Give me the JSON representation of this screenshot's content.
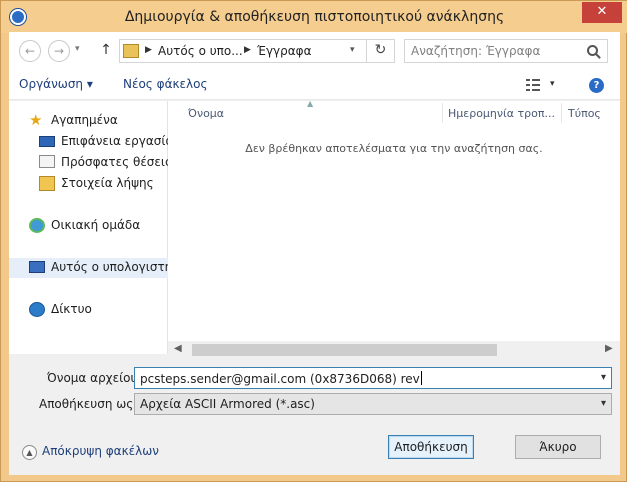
{
  "window": {
    "title": "Δημιουργία & αποθήκευση πιστοποιητικού ανάκλησης",
    "close_glyph": "✕"
  },
  "nav": {
    "back_glyph": "←",
    "forward_glyph": "→",
    "dropdown_glyph": "▾",
    "up_glyph": "↑",
    "breadcrumb": [
      "Αυτός ο υπο...",
      "Έγγραφα"
    ],
    "crumb_arrow": "▶",
    "refresh_glyph": "↻",
    "search_placeholder": "Αναζήτηση: Έγγραφα"
  },
  "toolbar": {
    "organize": "Οργάνωση ▾",
    "new_folder": "Νέος φάκελος",
    "view_dropdown_glyph": "▾",
    "help_glyph": "?"
  },
  "sidebar": {
    "items": [
      {
        "label": "Αγαπημένα",
        "icon": "star-icon"
      },
      {
        "label": "Επιφάνεια εργασίας",
        "icon": "desktop-icon"
      },
      {
        "label": "Πρόσφατες θέσεις",
        "icon": "recent-places-icon"
      },
      {
        "label": "Στοιχεία λήψης",
        "icon": "downloads-icon"
      },
      {
        "label": "Οικιακή ομάδα",
        "icon": "homegroup-icon"
      },
      {
        "label": "Αυτός ο υπολογιστής",
        "icon": "computer-icon",
        "selected": true
      },
      {
        "label": "Δίκτυο",
        "icon": "network-icon"
      }
    ],
    "star_glyph": "★"
  },
  "filelist": {
    "columns": [
      "Όνομα",
      "Ημερομηνία τροπ...",
      "Τύπος"
    ],
    "sort_glyph": "▲",
    "empty_message": "Δεν βρέθηκαν αποτελέσματα για την αναζήτηση σας.",
    "scroll_left_glyph": "◀",
    "scroll_right_glyph": "▶"
  },
  "form": {
    "filename_label": "Όνομα αρχείου:",
    "filename_value": "pcsteps.sender@gmail.com (0x8736D068) rev",
    "savetype_label": "Αποθήκευση ως:",
    "savetype_value": "Αρχεία ASCII Armored (*.asc)",
    "dropdown_glyph": "▾"
  },
  "footer": {
    "hide_folders": "Απόκρυψη φακέλων",
    "hide_glyph": "▲",
    "save": "Αποθήκευση",
    "cancel": "Άκυρο"
  },
  "colors": {
    "titlebar": "#f5cd8e",
    "close_button": "#c7413b",
    "link_text": "#1e3f7a",
    "focus_border": "#3c7fb1"
  }
}
